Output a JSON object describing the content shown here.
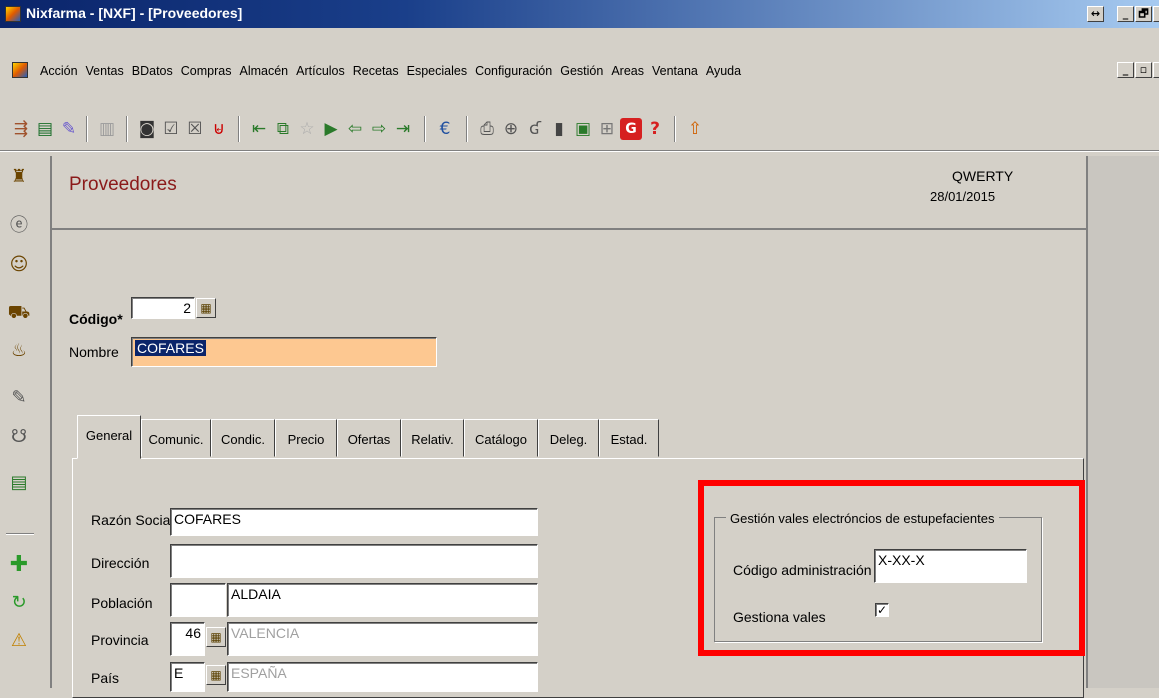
{
  "window": {
    "title": "Nixfarma - [NXF] - [Proveedores]",
    "buttons": [
      "↔",
      "_",
      "🗗",
      "x"
    ]
  },
  "menu": [
    "Acción",
    "Ventas",
    "BDatos",
    "Compras",
    "Almacén",
    "Artículos",
    "Recetas",
    "Especiales",
    "Configuración",
    "Gestión",
    "Areas",
    "Ventana",
    "Ayuda"
  ],
  "toolbar": {
    "groups": [
      [
        "exit-icon",
        "document-icon",
        "edit-icon"
      ],
      [
        "disabled-icon"
      ],
      [
        "binoculars-icon",
        "list-check-icon",
        "clear-icon",
        "filter-icon"
      ],
      [
        "first-icon",
        "copy-icon",
        "star-icon",
        "open-icon",
        "prev-icon",
        "next-icon",
        "last-icon"
      ],
      [
        "euro-icon"
      ],
      [
        "print-icon",
        "zoom-icon",
        "g-icon",
        "block-icon",
        "export-icon",
        "cart-icon",
        "g-red-icon",
        "help-icon"
      ],
      [
        "up-icon"
      ]
    ]
  },
  "vtoolbar": [
    "stamp-icon",
    "circle-e-icon",
    "person-icon",
    "cart-icon",
    "hands-icon",
    "pencil-icon",
    "people-icon",
    "register-icon",
    "add-icon",
    "refresh-icon",
    "warning-icon"
  ],
  "header": {
    "title": "Proveedores",
    "user": "QWERTY",
    "date": "28/01/2015"
  },
  "form": {
    "codigo_label": "Código*",
    "codigo_value": "2",
    "nombre_label": "Nombre",
    "nombre_value": "COFARES"
  },
  "tabs": [
    "General",
    "Comunic.",
    "Condic.",
    "Precio",
    "Ofertas",
    "Relativ.",
    "Catálogo",
    "Deleg.",
    "Estad."
  ],
  "general": {
    "razon_social_label": "Razón Social",
    "razon_social_value": "COFARES",
    "direccion_label": "Dirección",
    "direccion_value": "",
    "poblacion_label": "Población",
    "poblacion_code": "",
    "poblacion_value": "ALDAIA",
    "provincia_label": "Provincia",
    "provincia_code": "46",
    "provincia_value": "VALENCIA",
    "pais_label": "País",
    "pais_code": "E",
    "pais_value": "ESPAÑA"
  },
  "vales": {
    "group_title": "Gestión vales electróncios de estupefacientes",
    "codigo_admin_label": "Código administración",
    "codigo_admin_value": "X-XX-X",
    "gestiona_label": "Gestiona vales",
    "gestiona_checked": "✓"
  },
  "colors": {
    "title_bar": "#0a246a",
    "nombre_highlight": "#fdc891",
    "page_title": "#8b1a1a",
    "callout": "#ff0000"
  }
}
